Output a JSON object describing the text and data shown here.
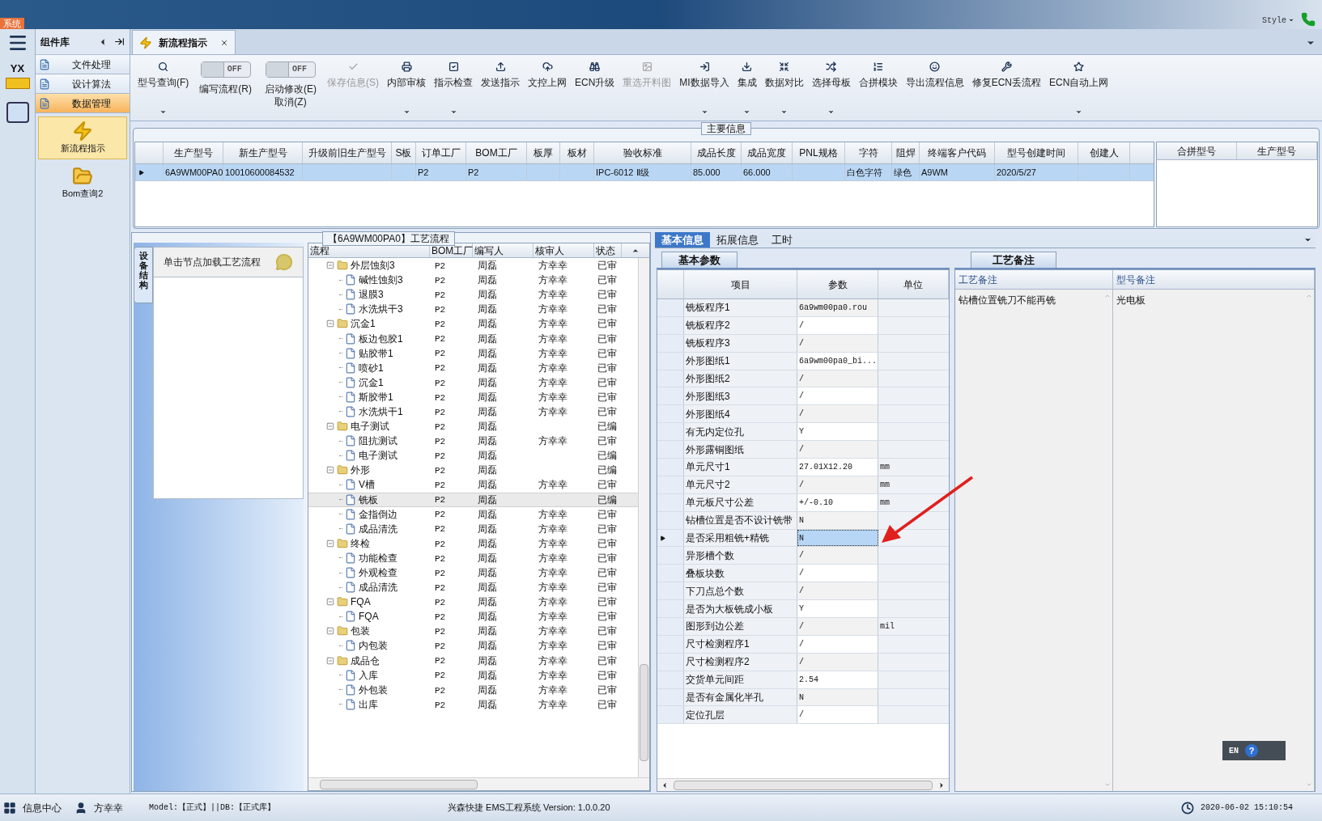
{
  "top_bar": {
    "system_menu": "系统",
    "style_menu": "Style"
  },
  "logo_text": "YX",
  "component_panel": {
    "title": "组件库",
    "groups": [
      {
        "label": "文件处理",
        "selected": false
      },
      {
        "label": "设计算法",
        "selected": false
      },
      {
        "label": "数据管理",
        "selected": true
      }
    ],
    "items": [
      {
        "label": "新流程指示",
        "selected": true,
        "kind": "bolt"
      },
      {
        "label": "Bom查询2",
        "selected": false,
        "kind": "folder"
      }
    ]
  },
  "document_tabs": [
    {
      "label": "新流程指示",
      "selected": true
    }
  ],
  "toolbar": [
    {
      "kind": "button",
      "label": "型号查询(F)",
      "disabled": false,
      "dropdown": true
    },
    {
      "kind": "toggle",
      "label": "编写流程(R)",
      "on": false,
      "state_label": "OFF"
    },
    {
      "kind": "toggle",
      "label": "启动修改(E)",
      "label2": "取消(Z)",
      "on": false,
      "state_label": "OFF"
    },
    {
      "kind": "button",
      "label": "保存信息(S)",
      "disabled": true,
      "dropdown": false
    },
    {
      "kind": "button",
      "label": "内部审核",
      "disabled": false,
      "dropdown": true
    },
    {
      "kind": "button",
      "label": "指示检查",
      "disabled": false,
      "dropdown": true
    },
    {
      "kind": "button",
      "label": "发送指示",
      "disabled": false,
      "dropdown": false
    },
    {
      "kind": "button",
      "label": "文控上网",
      "disabled": false,
      "dropdown": false
    },
    {
      "kind": "button",
      "label": "ECN升级",
      "disabled": false,
      "dropdown": false
    },
    {
      "kind": "button",
      "label": "重选开料图",
      "disabled": true,
      "dropdown": false
    },
    {
      "kind": "button",
      "label": "MI数据导入",
      "disabled": false,
      "dropdown": true
    },
    {
      "kind": "button",
      "label": "集成",
      "disabled": false,
      "dropdown": true
    },
    {
      "kind": "button",
      "label": "数据对比",
      "disabled": false,
      "dropdown": true
    },
    {
      "kind": "button",
      "label": "选择母板",
      "disabled": false,
      "dropdown": true
    },
    {
      "kind": "button",
      "label": "合拼模块",
      "disabled": false,
      "dropdown": false
    },
    {
      "kind": "button",
      "label": "导出流程信息",
      "disabled": false,
      "dropdown": false
    },
    {
      "kind": "button",
      "label": "修复ECN丢流程",
      "disabled": false,
      "dropdown": false
    },
    {
      "kind": "button",
      "label": "ECN自动上网",
      "disabled": false,
      "dropdown": true
    }
  ],
  "main_info": {
    "title": "主要信息",
    "columns": [
      "生产型号",
      "新生产型号",
      "升级前旧生产型号",
      "S板",
      "订单工厂",
      "BOM工厂",
      "板厚",
      "板材",
      "验收标准",
      "成品长度",
      "成品宽度",
      "PNL规格",
      "字符",
      "阻焊",
      "终端客户代码",
      "型号创建时间",
      "创建人"
    ],
    "rows": [
      {
        "selected": true,
        "cells": [
          "6A9WM00PA0",
          "10010600084532",
          null,
          null,
          "P2",
          "P2",
          null,
          null,
          "IPC-6012 Ⅱ级",
          "85.000",
          "66.000",
          null,
          "白色字符",
          "绿色",
          "A9WM",
          "2020/5/27",
          null
        ]
      }
    ],
    "side_columns": [
      "合拼型号",
      "生产型号"
    ]
  },
  "process_panel": {
    "title": "【6A9WM00PA0】工艺流程",
    "side_tab": "设备结构",
    "hint": "单击节点加载工艺流程",
    "columns": [
      "流程",
      "BOM工厂",
      "编写人",
      "核审人",
      "状态"
    ],
    "tree": [
      {
        "name": "外层蚀刻3",
        "bom": "P2",
        "writer": "周磊",
        "reviewer": "方幸幸",
        "status": "已审",
        "expanded": true,
        "selected": false,
        "children": [
          {
            "name": "碱性蚀刻3",
            "bom": "P2",
            "writer": "周磊",
            "reviewer": "方幸幸",
            "status": "已审",
            "selected": false
          },
          {
            "name": "退膜3",
            "bom": "P2",
            "writer": "周磊",
            "reviewer": "方幸幸",
            "status": "已审",
            "selected": false
          },
          {
            "name": "水洗烘干3",
            "bom": "P2",
            "writer": "周磊",
            "reviewer": "方幸幸",
            "status": "已审",
            "selected": false
          }
        ]
      },
      {
        "name": "沉金1",
        "bom": "P2",
        "writer": "周磊",
        "reviewer": "方幸幸",
        "status": "已审",
        "expanded": true,
        "selected": false,
        "children": [
          {
            "name": "板边包胶1",
            "bom": "P2",
            "writer": "周磊",
            "reviewer": "方幸幸",
            "status": "已审",
            "selected": false
          },
          {
            "name": "贴胶带1",
            "bom": "P2",
            "writer": "周磊",
            "reviewer": "方幸幸",
            "status": "已审",
            "selected": false
          },
          {
            "name": "喷砂1",
            "bom": "P2",
            "writer": "周磊",
            "reviewer": "方幸幸",
            "status": "已审",
            "selected": false
          },
          {
            "name": "沉金1",
            "bom": "P2",
            "writer": "周磊",
            "reviewer": "方幸幸",
            "status": "已审",
            "selected": false
          },
          {
            "name": "斯胶带1",
            "bom": "P2",
            "writer": "周磊",
            "reviewer": "方幸幸",
            "status": "已审",
            "selected": false
          },
          {
            "name": "水洗烘干1",
            "bom": "P2",
            "writer": "周磊",
            "reviewer": "方幸幸",
            "status": "已审",
            "selected": false
          }
        ]
      },
      {
        "name": "电子测试",
        "bom": "P2",
        "writer": "周磊",
        "status": "已编",
        "expanded": true,
        "selected": false,
        "children": [
          {
            "name": "阻抗测试",
            "bom": "P2",
            "writer": "周磊",
            "reviewer": "方幸幸",
            "status": "已审",
            "selected": false
          },
          {
            "name": "电子测试",
            "bom": "P2",
            "writer": "周磊",
            "status": "已编",
            "selected": false
          }
        ]
      },
      {
        "name": "外形",
        "bom": "P2",
        "writer": "周磊",
        "status": "已编",
        "expanded": true,
        "selected": false,
        "children": [
          {
            "name": "V槽",
            "bom": "P2",
            "writer": "周磊",
            "reviewer": "方幸幸",
            "status": "已审",
            "selected": false
          },
          {
            "name": "铣板",
            "bom": "P2",
            "writer": "周磊",
            "status": "已编",
            "selected": true
          },
          {
            "name": "金指倒边",
            "bom": "P2",
            "writer": "周磊",
            "reviewer": "方幸幸",
            "status": "已审",
            "selected": false
          },
          {
            "name": "成品清洗",
            "bom": "P2",
            "writer": "周磊",
            "reviewer": "方幸幸",
            "status": "已审",
            "selected": false
          }
        ]
      },
      {
        "name": "终检",
        "bom": "P2",
        "writer": "周磊",
        "reviewer": "方幸幸",
        "status": "已审",
        "expanded": true,
        "selected": false,
        "children": [
          {
            "name": "功能检查",
            "bom": "P2",
            "writer": "周磊",
            "reviewer": "方幸幸",
            "status": "已审",
            "selected": false
          },
          {
            "name": "外观检查",
            "bom": "P2",
            "writer": "周磊",
            "reviewer": "方幸幸",
            "status": "已审",
            "selected": false
          },
          {
            "name": "成品清洗",
            "bom": "P2",
            "writer": "周磊",
            "reviewer": "方幸幸",
            "status": "已审",
            "selected": false
          }
        ]
      },
      {
        "name": "FQA",
        "bom": "P2",
        "writer": "周磊",
        "reviewer": "方幸幸",
        "status": "已审",
        "expanded": true,
        "selected": false,
        "children": [
          {
            "name": "FQA",
            "bom": "P2",
            "writer": "周磊",
            "reviewer": "方幸幸",
            "status": "已审",
            "selected": false
          }
        ]
      },
      {
        "name": "包装",
        "bom": "P2",
        "writer": "周磊",
        "reviewer": "方幸幸",
        "status": "已审",
        "expanded": true,
        "selected": false,
        "children": [
          {
            "name": "内包装",
            "bom": "P2",
            "writer": "周磊",
            "reviewer": "方幸幸",
            "status": "已审",
            "selected": false
          }
        ]
      },
      {
        "name": "成品仓",
        "bom": "P2",
        "writer": "周磊",
        "reviewer": "方幸幸",
        "status": "已审",
        "expanded": true,
        "selected": false,
        "children": [
          {
            "name": "入库",
            "bom": "P2",
            "writer": "周磊",
            "reviewer": "方幸幸",
            "status": "已审",
            "selected": false
          },
          {
            "name": "外包装",
            "bom": "P2",
            "writer": "周磊",
            "reviewer": "方幸幸",
            "status": "已审",
            "selected": false
          },
          {
            "name": "出库",
            "bom": "P2",
            "writer": "周磊",
            "reviewer": "方幸幸",
            "status": "已审",
            "selected": false
          }
        ]
      }
    ]
  },
  "detail_tabs": [
    {
      "label": "基本信息",
      "selected": true
    },
    {
      "label": "拓展信息",
      "selected": false
    },
    {
      "label": "工时",
      "selected": false
    }
  ],
  "params": {
    "tab": "基本参数",
    "columns": [
      "项目",
      "参数",
      "单位"
    ],
    "rows": [
      {
        "item": "铣板程序1",
        "value": "6a9wm00pa0.rou",
        "selected": false
      },
      {
        "item": "铣板程序2",
        "value": "/",
        "selected": false
      },
      {
        "item": "铣板程序3",
        "value": "/",
        "selected": false
      },
      {
        "item": "外形图纸1",
        "value": "6a9wm00pa0_bi...",
        "selected": false
      },
      {
        "item": "外形图纸2",
        "value": "/",
        "selected": false
      },
      {
        "item": "外形图纸3",
        "value": "/",
        "selected": false
      },
      {
        "item": "外形图纸4",
        "value": "/",
        "selected": false
      },
      {
        "item": "有无内定位孔",
        "value": "Y",
        "selected": false
      },
      {
        "item": "外形露铜图纸",
        "value": "/",
        "selected": false
      },
      {
        "item": "单元尺寸1",
        "value": "27.01X12.20",
        "unit": "mm",
        "selected": false
      },
      {
        "item": "单元尺寸2",
        "value": "/",
        "unit": "mm",
        "selected": false
      },
      {
        "item": "单元板尺寸公差",
        "value": "+/-0.10",
        "unit": "mm",
        "selected": false
      },
      {
        "item": "钻槽位置是否不设计铣带",
        "value": "N",
        "selected": false
      },
      {
        "item": "是否采用粗铣+精铣",
        "value": "N",
        "selected": true
      },
      {
        "item": "异形槽个数",
        "value": "/",
        "selected": false
      },
      {
        "item": "叠板块数",
        "value": "/",
        "selected": false
      },
      {
        "item": "下刀点总个数",
        "value": "/",
        "selected": false
      },
      {
        "item": "是否为大板铣成小板",
        "value": "Y",
        "selected": false
      },
      {
        "item": "图形到边公差",
        "value": "/",
        "unit": "mil",
        "selected": false
      },
      {
        "item": "尺寸检测程序1",
        "value": "/",
        "selected": false
      },
      {
        "item": "尺寸检测程序2",
        "value": "/",
        "selected": false
      },
      {
        "item": "交货单元间距",
        "value": "2.54",
        "selected": false
      },
      {
        "item": "是否有金属化半孔",
        "value": "N",
        "selected": false
      },
      {
        "item": "定位孔层",
        "value": "/",
        "selected": false
      }
    ]
  },
  "annotations": [
    {
      "kind": "arrow"
    }
  ],
  "remarks": {
    "tab": "工艺备注",
    "columns": [
      {
        "label": "工艺备注",
        "text": "钻槽位置铣刀不能再铣"
      },
      {
        "label": "型号备注",
        "text": "光电板"
      }
    ]
  },
  "language_widget": {
    "label": "EN",
    "help": "?"
  },
  "status_bar": {
    "info_center": "信息中心",
    "user": "方幸幸",
    "model": "Model:【正式】||DB:【正式库】",
    "app": "兴森快捷 EMS工程系统 Version: 1.0.0.20",
    "time": "2020-06-02 15:10:54"
  }
}
